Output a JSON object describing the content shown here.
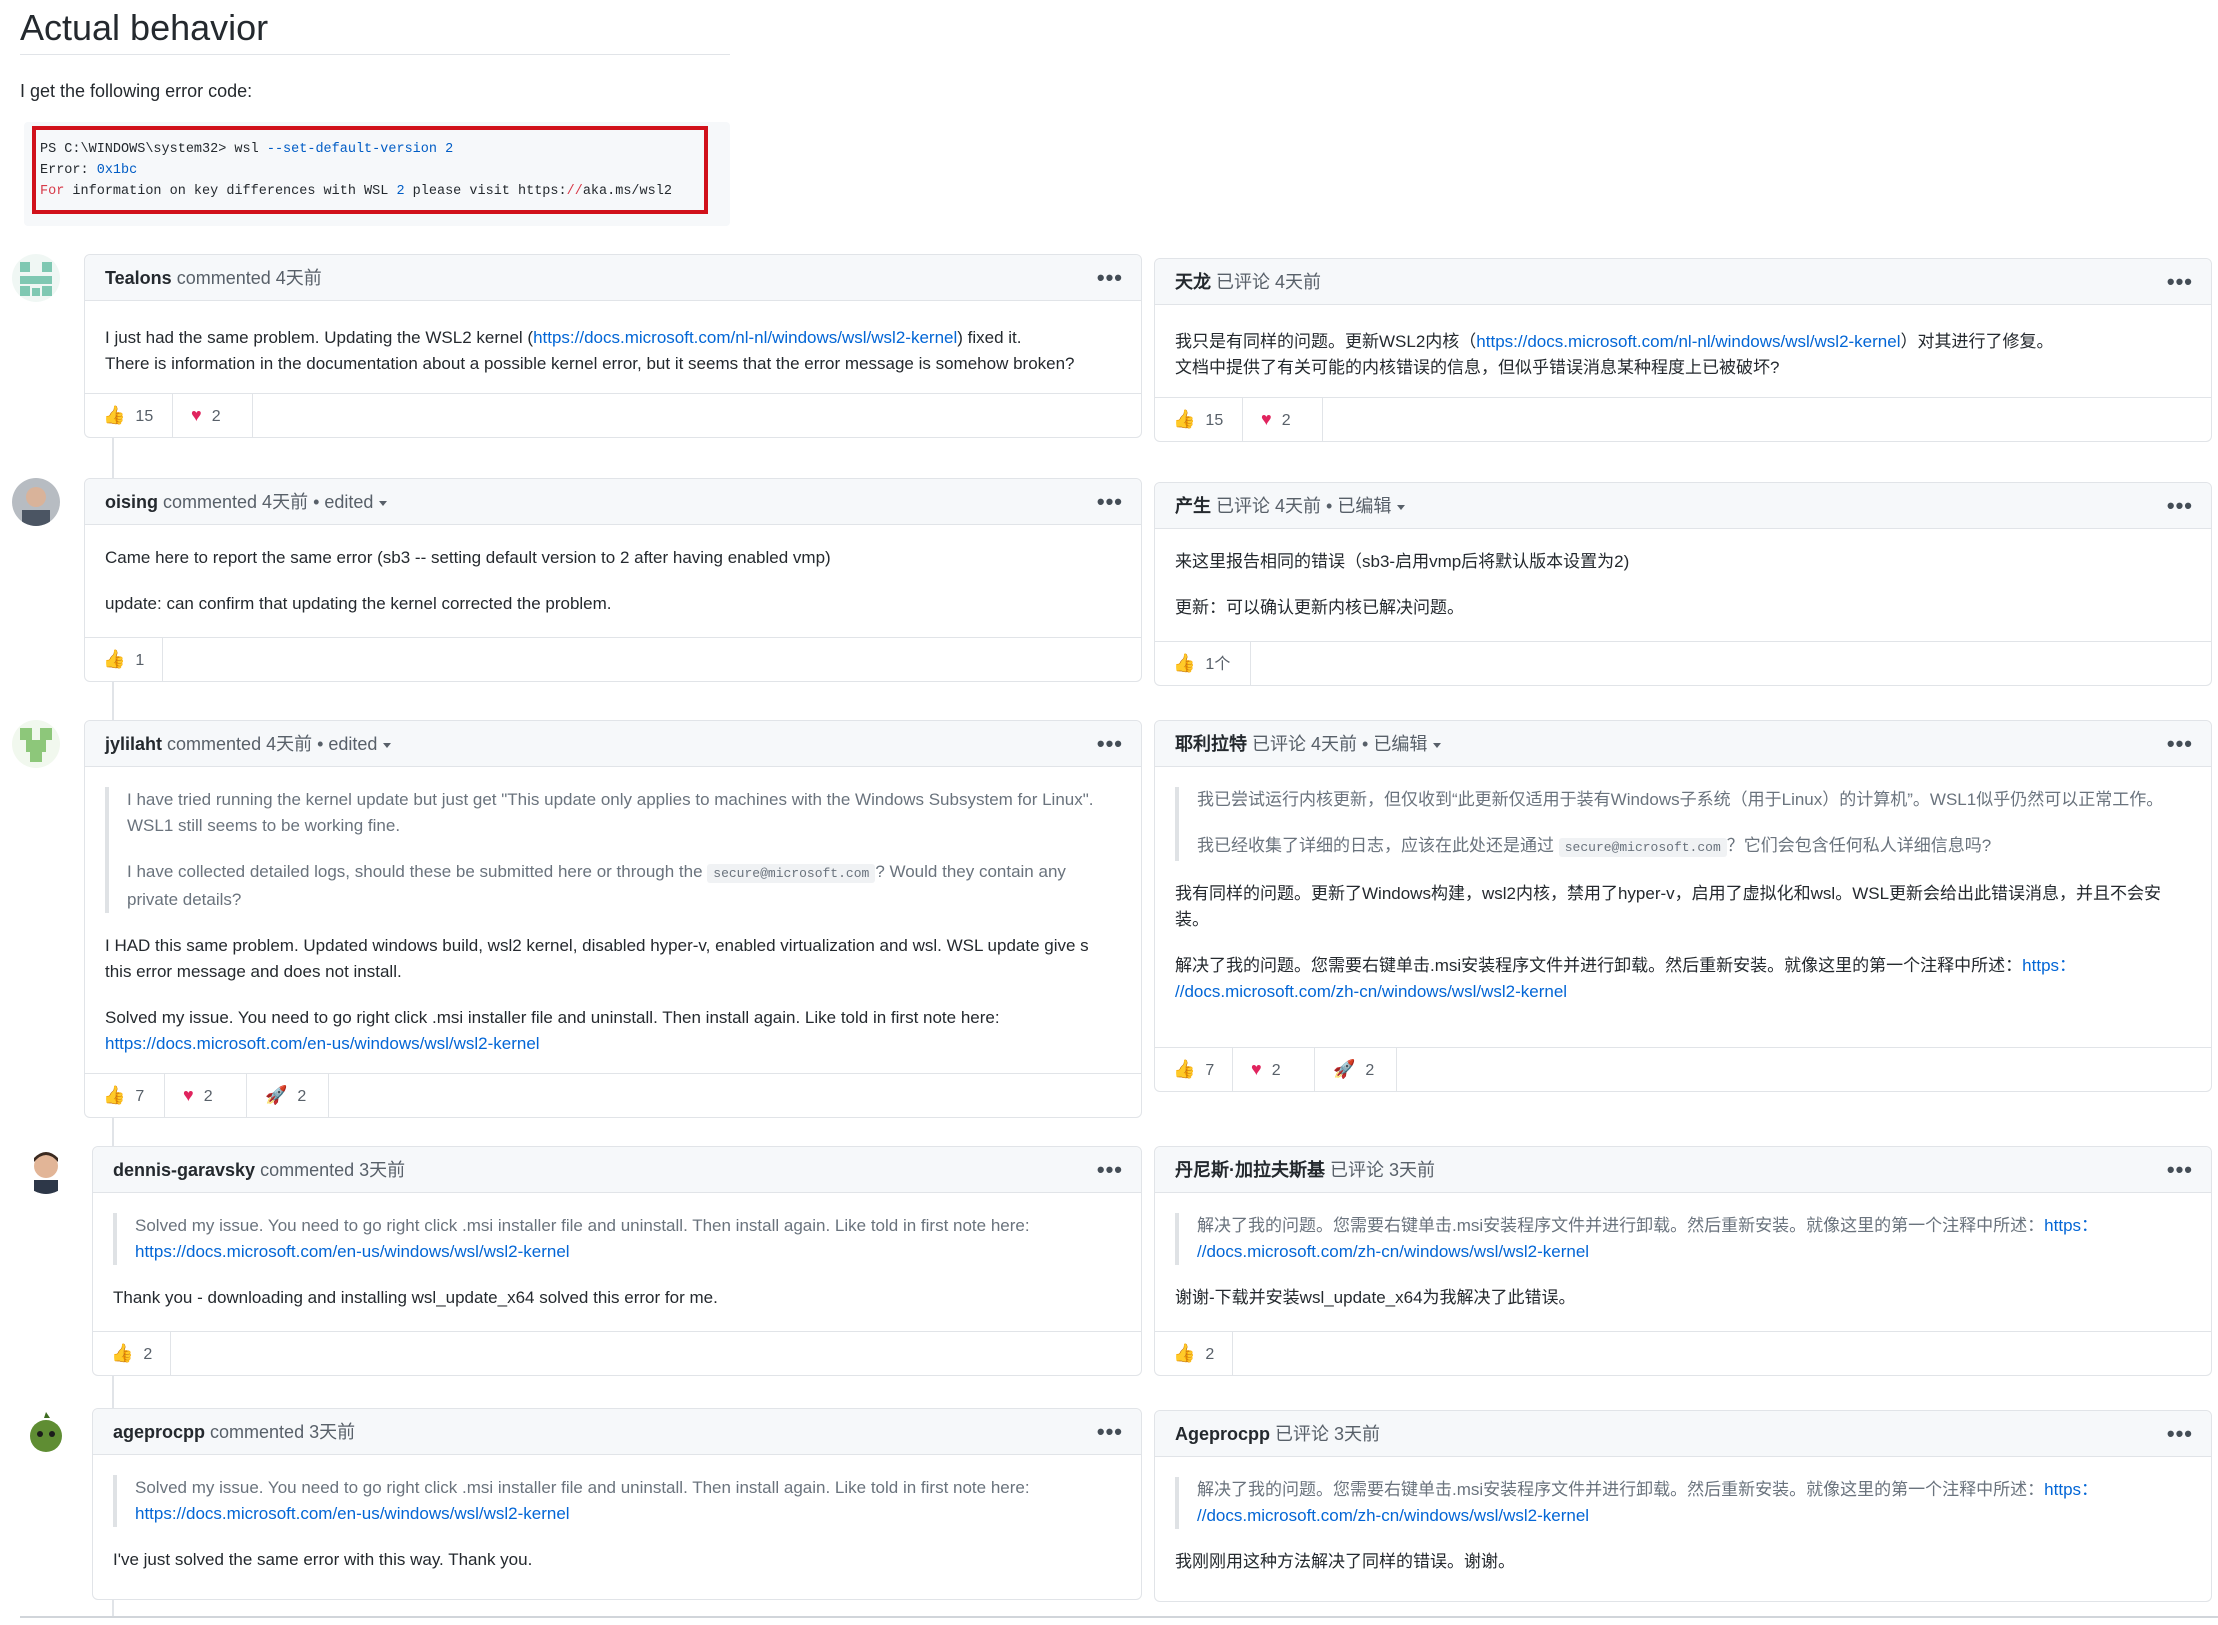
{
  "heading": "Actual behavior",
  "intro": "I get the following error code:",
  "code": {
    "line1_prompt": "PS C:\\WINDOWS\\system32> wsl ",
    "line1_flag": "--set-default-version",
    "line1_num": "2",
    "line2_label": "Error: ",
    "line2_code": "0x1bc",
    "line3_for": "For",
    "line3_text": " information on key differences with WSL ",
    "line3_num": "2",
    "line3_text2": " please visit https:",
    "line3_slashes": "//",
    "line3_url": "aka.ms/wsl2"
  },
  "left": [
    {
      "author": "Tealons",
      "meta": "commented 4天前",
      "p1_a": "I just had the same problem. Updating the WSL2 kernel (",
      "p1_link": "https://docs.microsoft.com/nl-nl/windows/wsl/wsl2-kernel",
      "p1_b": ") fixed it.",
      "p2": "There is information in the documentation about a possible kernel error, but it seems that the error message is somehow broken?",
      "thumbs": "15",
      "hearts": "2"
    },
    {
      "author": "oising",
      "meta": "commented 4天前 • edited",
      "p1": "Came here to report the same error (sb3 -- setting default version to 2 after having enabled vmp)",
      "p2": "update: can confirm that updating the kernel corrected the problem.",
      "thumbs": "1"
    },
    {
      "author": "jylilaht",
      "meta": "commented 4天前 • edited",
      "q1": "I have tried running the kernel update but just get \"This update only applies to machines with the Windows Subsystem for Linux\". WSL1 still seems to be working fine.",
      "q2_a": "I have collected detailed logs, should these be submitted here or through the ",
      "q2_code": "secure@microsoft.com",
      "q2_b": "? Would they contain any private details?",
      "p1": "I HAD this same problem. Updated windows build, wsl2 kernel, disabled hyper-v, enabled virtualization and wsl. WSL update give s this error message and does not install.",
      "p2": "Solved my issue. You need to go right click .msi installer file and uninstall. Then install again. Like told in first note here:",
      "p2_link": "https://docs.microsoft.com/en-us/windows/wsl/wsl2-kernel",
      "thumbs": "7",
      "hearts": "2",
      "rockets": "2"
    },
    {
      "author": "dennis-garavsky",
      "meta": "commented 3天前",
      "q1": "Solved my issue. You need to go right click .msi installer file and uninstall. Then install again. Like told in first note here:",
      "q1_link": "https://docs.microsoft.com/en-us/windows/wsl/wsl2-kernel",
      "p1": "Thank you - downloading and installing wsl_update_x64 solved this error for me.",
      "thumbs": "2"
    },
    {
      "author": "ageprocpp",
      "meta": "commented 3天前",
      "q1": "Solved my issue. You need to go right click .msi installer file and uninstall. Then install again. Like told in first note here:",
      "q1_link": "https://docs.microsoft.com/en-us/windows/wsl/wsl2-kernel",
      "p1": "I've just solved the same error with this way. Thank you."
    }
  ],
  "right": [
    {
      "author": "天龙",
      "meta": "已评论 4天前",
      "p1_a": "我只是有同样的问题。更新WSL2内核（",
      "p1_link": "https://docs.microsoft.com/nl-nl/windows/wsl/wsl2-kernel",
      "p1_b": "）对其进行了修复。",
      "p2": "文档中提供了有关可能的内核错误的信息，但似乎错误消息某种程度上已被破坏?",
      "thumbs": "15",
      "hearts": "2"
    },
    {
      "author": "产生",
      "meta": "已评论 4天前 • 已编辑",
      "p1": "来这里报告相同的错误（sb3-启用vmp后将默认版本设置为2)",
      "p2": "更新：可以确认更新内核已解决问题。",
      "thumbs": "1个"
    },
    {
      "author": "耶利拉特",
      "meta": "已评论 4天前 • 已编辑",
      "q1": "我已尝试运行内核更新，但仅收到“此更新仅适用于装有Windows子系统（用于Linux）的计算机”。WSL1似乎仍然可以正常工作。",
      "q2_a": "我已经收集了详细的日志，应该在此处还是通过 ",
      "q2_code": "secure@microsoft.com",
      "q2_b": "？它们会包含任何私人详细信息吗?",
      "p1": "我有同样的问题。更新了Windows构建，wsl2内核，禁用了hyper-v，启用了虚拟化和wsl。WSL更新会给出此错误消息，并且不会安装。",
      "p2": "解决了我的问题。您需要右键单击.msi安装程序文件并进行卸载。然后重新安装。就像这里的第一个注释中所述：",
      "p2_link_a": "https：",
      "p2_link": "//docs.microsoft.com/zh-cn/windows/wsl/wsl2-kernel",
      "thumbs": "7",
      "hearts": "2",
      "rockets": "2"
    },
    {
      "author": "丹尼斯·加拉夫斯基",
      "meta": "已评论 3天前",
      "q1": "解决了我的问题。您需要右键单击.msi安装程序文件并进行卸载。然后重新安装。就像这里的第一个注释中所述：",
      "q1_link_a": "https：",
      "q1_link": "//docs.microsoft.com/zh-cn/windows/wsl/wsl2-kernel",
      "p1": "谢谢-下载并安装wsl_update_x64为我解决了此错误。",
      "thumbs": "2"
    },
    {
      "author": "Ageprocpp",
      "meta": "已评论 3天前",
      "q1": "解决了我的问题。您需要右键单击.msi安装程序文件并进行卸载。然后重新安装。就像这里的第一个注释中所述：",
      "q1_link_a": "https：",
      "q1_link": "//docs.microsoft.com/zh-cn/windows/wsl/wsl2-kernel",
      "p1": "我刚刚用这种方法解决了同样的错误。谢谢。"
    }
  ],
  "ui": {
    "more": "•••"
  },
  "icons": {
    "thumbs": "thumbs-up-icon",
    "heart": "heart-icon",
    "rocket": "rocket-icon",
    "more": "kebab-menu-icon",
    "caret": "caret-down-icon"
  },
  "colors": {
    "link": "#0366d6",
    "highlight_frame": "#d1111b",
    "heart": "#e0245e",
    "thumb": "#f0b429"
  }
}
